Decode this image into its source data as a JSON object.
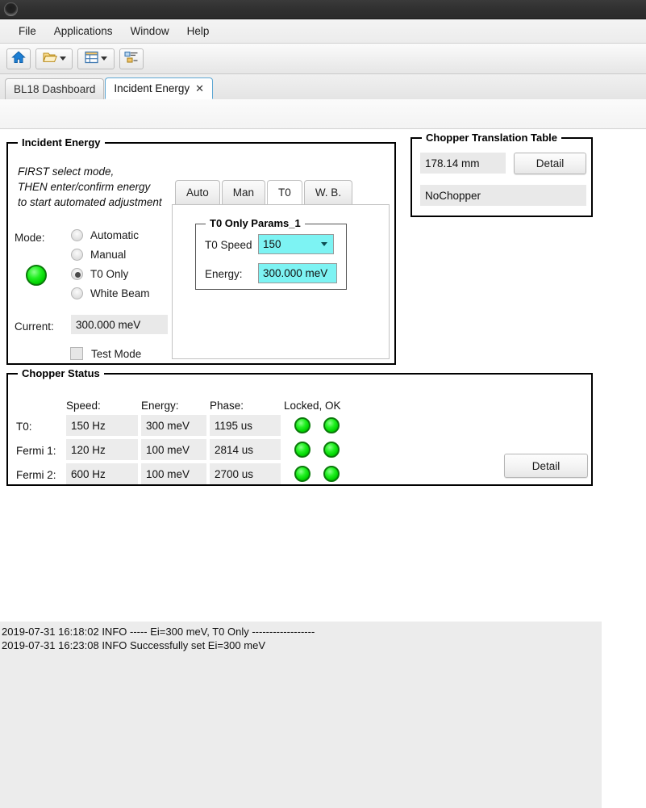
{
  "window": {
    "icon": "app-orb-icon"
  },
  "menubar": {
    "items": [
      "File",
      "Applications",
      "Window",
      "Help"
    ]
  },
  "toolbar": {
    "buttons": [
      {
        "name": "home-button",
        "icon": "home-icon"
      },
      {
        "name": "open-button",
        "icon": "folder-open-icon"
      },
      {
        "name": "layout-button",
        "icon": "table-layout-icon"
      },
      {
        "name": "perspective-button",
        "icon": "perspective-icon"
      }
    ]
  },
  "tabs": {
    "items": [
      {
        "label": "BL18 Dashboard",
        "selected": false,
        "closable": false
      },
      {
        "label": "Incident Energy",
        "selected": true,
        "closable": true,
        "close_glyph": "✕"
      }
    ]
  },
  "incident_energy": {
    "title": "Incident Energy",
    "instructions": [
      "FIRST select mode,",
      "THEN enter/confirm energy",
      "to start automated adjustment"
    ],
    "mode_label": "Mode:",
    "modes": [
      {
        "label": "Automatic",
        "selected": false
      },
      {
        "label": "Manual",
        "selected": false
      },
      {
        "label": "T0 Only",
        "selected": true
      },
      {
        "label": "White Beam",
        "selected": false
      }
    ],
    "status_led": {
      "name": "mode-status-led",
      "color": "#00d200"
    },
    "current_label": "Current:",
    "current_value": "300.000 meV",
    "test_mode_label": "Test Mode",
    "test_mode_checked": false,
    "inner_tabs": [
      {
        "label": "Auto",
        "selected": false
      },
      {
        "label": "Man",
        "selected": false
      },
      {
        "label": "T0",
        "selected": true
      },
      {
        "label": "W. B.",
        "selected": false
      }
    ],
    "params": {
      "title": "T0 Only Params_1",
      "t0_speed_label": "T0 Speed",
      "t0_speed_value": "150",
      "energy_label": "Energy:",
      "energy_value": "300.000 meV",
      "field_color": "#7df3f3"
    }
  },
  "chopper_translation_table": {
    "title": "Chopper Translation Table",
    "position_value": "178.14 mm",
    "detail_label": "Detail",
    "chopper_value": "NoChopper"
  },
  "chopper_status": {
    "title": "Chopper Status",
    "columns": [
      "Speed:",
      "Energy:",
      "Phase:",
      "Locked, OK"
    ],
    "rows": [
      {
        "name": "T0:",
        "speed": "150 Hz",
        "energy": "300 meV",
        "phase": "1195 us",
        "locked": true,
        "ok": true
      },
      {
        "name": "Fermi 1:",
        "speed": "120 Hz",
        "energy": "100 meV",
        "phase": "2814 us",
        "locked": true,
        "ok": true
      },
      {
        "name": "Fermi 2:",
        "speed": "600 Hz",
        "energy": "100 meV",
        "phase": "2700 us",
        "locked": true,
        "ok": true
      }
    ],
    "detail_label": "Detail"
  },
  "log": {
    "lines": [
      "2019-07-31 16:18:02 INFO ----- Ei=300 meV, T0 Only ------------------",
      "2019-07-31 16:23:08 INFO Successfully set Ei=300 meV"
    ]
  }
}
